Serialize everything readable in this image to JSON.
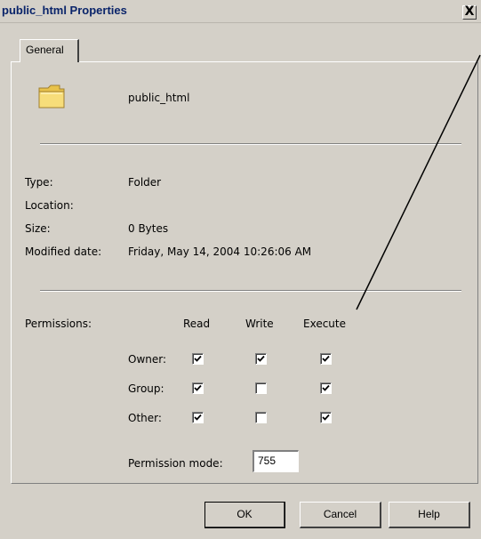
{
  "window": {
    "title": "public_html Properties",
    "close_label": "X"
  },
  "tabs": [
    {
      "label": "General"
    }
  ],
  "folder": {
    "icon": "folder-icon",
    "name": "public_html"
  },
  "info": {
    "type_label": "Type:",
    "type_value": "Folder",
    "location_label": "Location:",
    "location_value": "",
    "size_label": "Size:",
    "size_value": "0 Bytes",
    "modified_label": "Modified date:",
    "modified_value": "Friday, May 14, 2004 10:26:06 AM"
  },
  "permissions": {
    "label": "Permissions:",
    "columns": [
      "Read",
      "Write",
      "Execute"
    ],
    "rows": [
      {
        "label": "Owner:",
        "read": true,
        "write": true,
        "execute": true
      },
      {
        "label": "Group:",
        "read": true,
        "write": false,
        "execute": true
      },
      {
        "label": "Other:",
        "read": true,
        "write": false,
        "execute": true
      }
    ],
    "mode_label": "Permission mode:",
    "mode_value": "755"
  },
  "buttons": {
    "ok": "OK",
    "cancel": "Cancel",
    "help": "Help"
  },
  "colors": {
    "dialog_bg": "#d4d0c8",
    "title_text": "#0a246a",
    "folder": "#f5d56e"
  }
}
